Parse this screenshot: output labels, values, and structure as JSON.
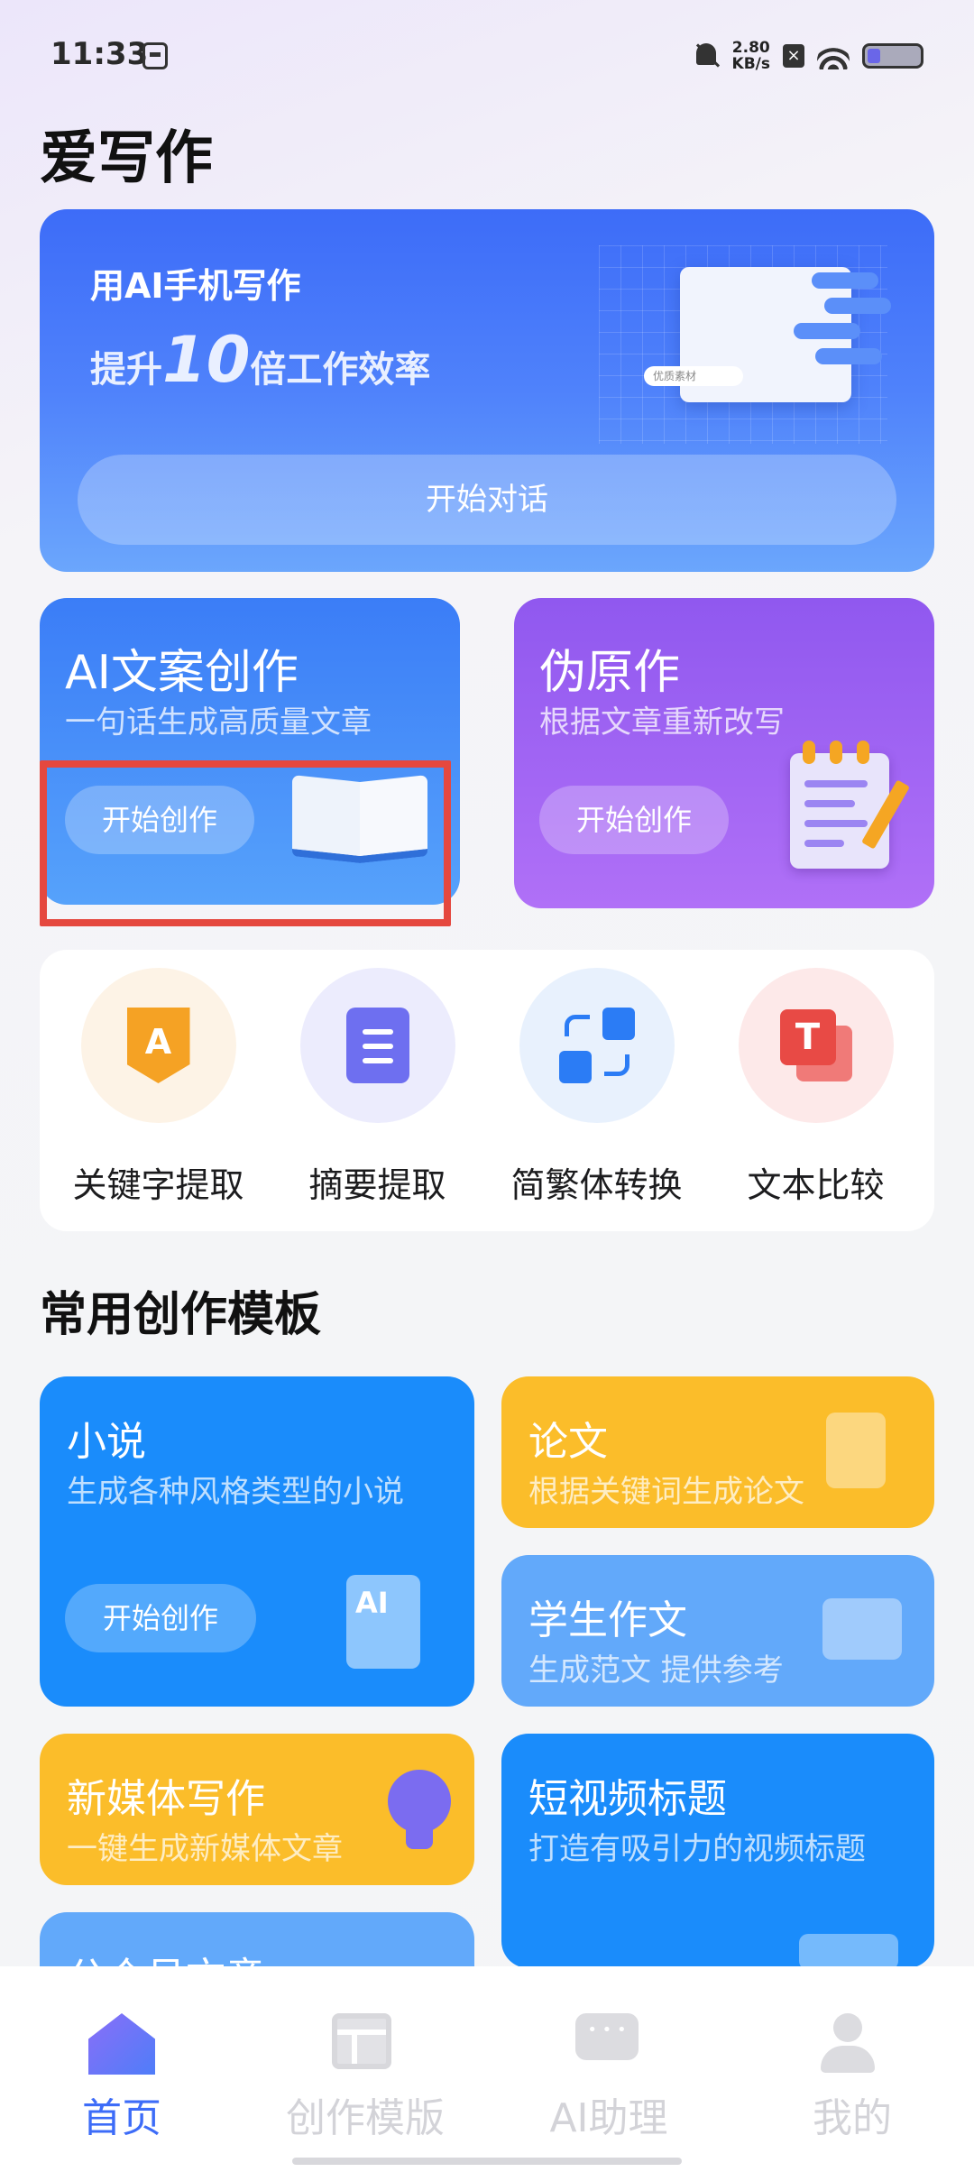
{
  "status_bar": {
    "time": "11:33",
    "net_speed_value": "2.80",
    "net_speed_unit": "KB/s"
  },
  "app_title": "爱写作",
  "hero": {
    "line1": "用AI手机写作",
    "line2_prefix": "提升",
    "line2_number": "10",
    "line2_suffix": "倍工作效率",
    "search_hint": "优质素材",
    "button": "开始对话"
  },
  "features": [
    {
      "title": "AI文案创作",
      "subtitle": "一句话生成高质量文章",
      "button": "开始创作",
      "color": "#3b7df7"
    },
    {
      "title": "伪原作",
      "subtitle": "根据文章重新改写",
      "button": "开始创作",
      "color": "#9058ef"
    }
  ],
  "tools": [
    {
      "label": "关键字提取",
      "icon": "keyword-icon",
      "icon_text": "A",
      "bg": "#fdf3e6"
    },
    {
      "label": "摘要提取",
      "icon": "summary-icon",
      "bg": "#ececfd"
    },
    {
      "label": "简繁体转换",
      "icon": "convert-icon",
      "bg": "#e8f1fd"
    },
    {
      "label": "文本比较",
      "icon": "compare-icon",
      "icon_text": "T",
      "bg": "#fde9e9"
    }
  ],
  "section_title": "常用创作模板",
  "templates": {
    "novel": {
      "title": "小说",
      "subtitle": "生成各种风格类型的小说",
      "button": "开始创作",
      "icon_text": "AI"
    },
    "paper": {
      "title": "论文",
      "subtitle": "根据关键词生成论文"
    },
    "essay": {
      "title": "学生作文",
      "subtitle": "生成范文 提供参考"
    },
    "media": {
      "title": "新媒体写作",
      "subtitle": "一键生成新媒体文章"
    },
    "video": {
      "title": "短视频标题",
      "subtitle": "打造有吸引力的视频标题"
    },
    "gzh": {
      "title": "公众号文章"
    }
  },
  "nav": [
    {
      "label": "首页",
      "active": true
    },
    {
      "label": "创作模版",
      "active": false
    },
    {
      "label": "AI助理",
      "active": false
    },
    {
      "label": "我的",
      "active": false
    }
  ],
  "colors": {
    "primary": "#3d6cf8",
    "highlight_box": "#e5483f",
    "yellow": "#fbbd2a",
    "blue": "#1a8cfb"
  }
}
